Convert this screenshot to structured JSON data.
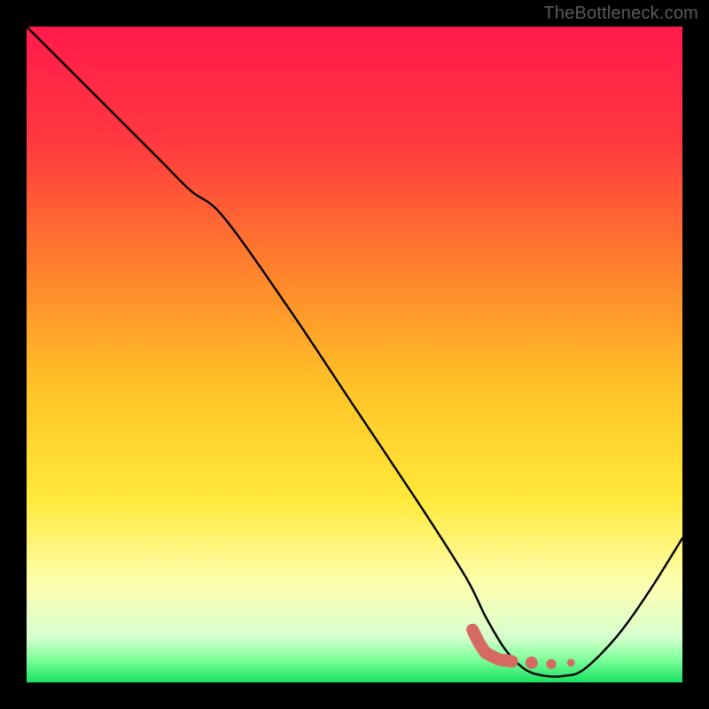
{
  "watermark": "TheBottleneck.com",
  "chart_data": {
    "type": "line",
    "title": "",
    "xlabel": "",
    "ylabel": "",
    "xlim": [
      0,
      100
    ],
    "ylim": [
      0,
      100
    ],
    "series": [
      {
        "name": "bottleneck-curve",
        "x": [
          0,
          10,
          20,
          25,
          30,
          40,
          50,
          60,
          67,
          70,
          73,
          76,
          79,
          82,
          85,
          90,
          95,
          100
        ],
        "y": [
          100,
          90,
          80,
          75,
          71,
          57,
          42,
          27,
          16,
          10,
          5,
          2,
          1,
          1,
          2,
          7,
          14,
          22
        ]
      }
    ],
    "markers": {
      "name": "optimal-region",
      "color": "#d66a62",
      "points": [
        {
          "x": 68,
          "y": 8
        },
        {
          "x": 69,
          "y": 6
        },
        {
          "x": 70,
          "y": 4.5
        },
        {
          "x": 72,
          "y": 3.5
        },
        {
          "x": 74,
          "y": 3.2
        },
        {
          "x": 77,
          "y": 3.0
        },
        {
          "x": 80,
          "y": 2.8
        },
        {
          "x": 83,
          "y": 3.0
        }
      ]
    },
    "gradient_stops": [
      {
        "offset": 0.0,
        "color": "#ff1a4b"
      },
      {
        "offset": 0.18,
        "color": "#ff3a3f"
      },
      {
        "offset": 0.35,
        "color": "#ff7a2e"
      },
      {
        "offset": 0.55,
        "color": "#ffc327"
      },
      {
        "offset": 0.72,
        "color": "#ffe93a"
      },
      {
        "offset": 0.85,
        "color": "#fdffb0"
      },
      {
        "offset": 0.93,
        "color": "#d7ffce"
      },
      {
        "offset": 0.965,
        "color": "#7eff9a"
      },
      {
        "offset": 1.0,
        "color": "#18e060"
      }
    ]
  }
}
